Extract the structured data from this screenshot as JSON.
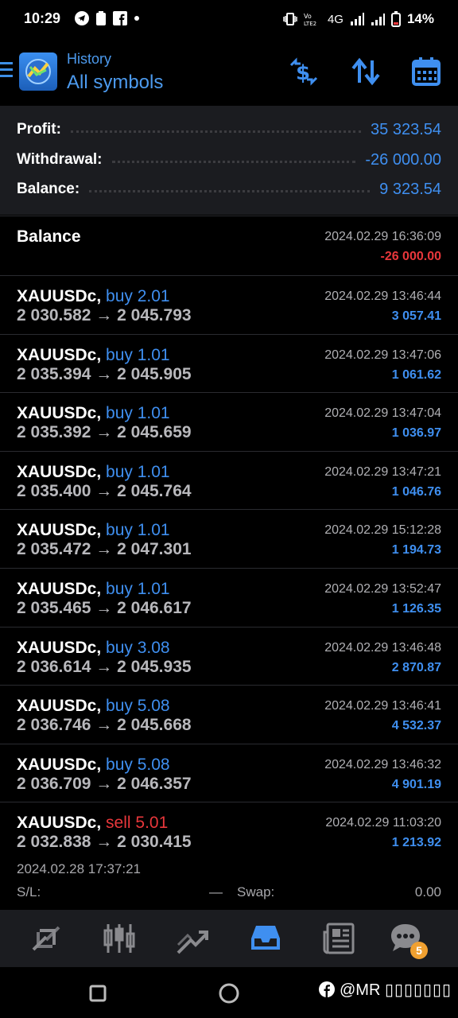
{
  "status_bar": {
    "time": "10:29",
    "network": "4G",
    "battery": "14%"
  },
  "header": {
    "subtitle": "History",
    "title": "All symbols",
    "accent": "#3f8ff0",
    "icons": [
      "currency-exchange-icon",
      "sort-icon",
      "calendar-icon"
    ]
  },
  "summary": {
    "profit_label": "Profit:",
    "profit_value": "35 323.54",
    "withdrawal_label": "Withdrawal:",
    "withdrawal_value": "-26 000.00",
    "balance_label": "Balance:",
    "balance_value": "9 323.54"
  },
  "balance_entry": {
    "label": "Balance",
    "datetime": "2024.02.29 16:36:09",
    "amount": "-26 000.00"
  },
  "deals": [
    {
      "symbol": "XAUUSDc,",
      "side": "buy 2.01",
      "open": "2 030.582",
      "close": "2 045.793",
      "datetime": "2024.02.29 13:46:44",
      "profit": "3 057.41",
      "type": "buy"
    },
    {
      "symbol": "XAUUSDc,",
      "side": "buy 1.01",
      "open": "2 035.394",
      "close": "2 045.905",
      "datetime": "2024.02.29 13:47:06",
      "profit": "1 061.62",
      "type": "buy"
    },
    {
      "symbol": "XAUUSDc,",
      "side": "buy 1.01",
      "open": "2 035.392",
      "close": "2 045.659",
      "datetime": "2024.02.29 13:47:04",
      "profit": "1 036.97",
      "type": "buy"
    },
    {
      "symbol": "XAUUSDc,",
      "side": "buy 1.01",
      "open": "2 035.400",
      "close": "2 045.764",
      "datetime": "2024.02.29 13:47:21",
      "profit": "1 046.76",
      "type": "buy"
    },
    {
      "symbol": "XAUUSDc,",
      "side": "buy 1.01",
      "open": "2 035.472",
      "close": "2 047.301",
      "datetime": "2024.02.29 15:12:28",
      "profit": "1 194.73",
      "type": "buy"
    },
    {
      "symbol": "XAUUSDc,",
      "side": "buy 1.01",
      "open": "2 035.465",
      "close": "2 046.617",
      "datetime": "2024.02.29 13:52:47",
      "profit": "1 126.35",
      "type": "buy"
    },
    {
      "symbol": "XAUUSDc,",
      "side": "buy 3.08",
      "open": "2 036.614",
      "close": "2 045.935",
      "datetime": "2024.02.29 13:46:48",
      "profit": "2 870.87",
      "type": "buy"
    },
    {
      "symbol": "XAUUSDc,",
      "side": "buy 5.08",
      "open": "2 036.746",
      "close": "2 045.668",
      "datetime": "2024.02.29 13:46:41",
      "profit": "4 532.37",
      "type": "buy"
    },
    {
      "symbol": "XAUUSDc,",
      "side": "buy 5.08",
      "open": "2 036.709",
      "close": "2 046.357",
      "datetime": "2024.02.29 13:46:32",
      "profit": "4 901.19",
      "type": "buy"
    },
    {
      "symbol": "XAUUSDc,",
      "side": "sell 5.01",
      "open": "2 032.838",
      "close": "2 030.415",
      "datetime": "2024.02.29 11:03:20",
      "profit": "1 213.92",
      "type": "sell"
    }
  ],
  "arrow": "→",
  "expanded": {
    "open_datetime": "2024.02.28 17:37:21",
    "sl_label": "S/L:",
    "sl_value": "—",
    "swap_label": "Swap:",
    "swap_value": "0.00"
  },
  "bottom_nav": {
    "items": [
      "quotes-icon",
      "chart-icon",
      "trade-icon",
      "history-icon",
      "news-icon",
      "messages-icon"
    ],
    "messages_badge": "5"
  },
  "watermark": "@MR "
}
